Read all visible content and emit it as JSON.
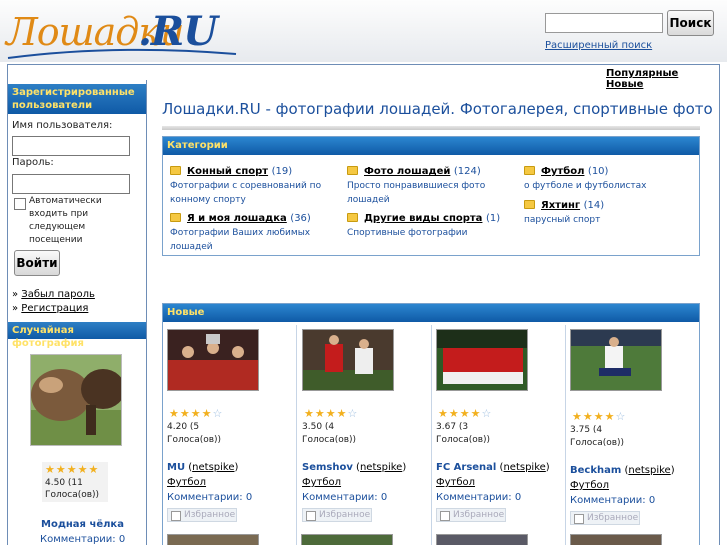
{
  "header": {
    "logo_cyr": "Лошадки",
    "logo_ru": ".RU",
    "search_button": "Поиск",
    "search_value": "",
    "advanced_search": "Расширенный поиск"
  },
  "toplinks": {
    "popular": "Популярные",
    "new": "Новые"
  },
  "sidebar": {
    "registered_heading": "Зарегистрированные пользователи",
    "username_label": "Имя пользователя:",
    "password_label": "Пароль:",
    "remember_label": "Автоматически входить при следующем посещении",
    "login_button": "Войти",
    "forgot_password": "Забыл пароль",
    "register": "Регистрация",
    "random_heading": "Случайная фотография",
    "random": {
      "rating_value": "4.50 (11",
      "votes": "Голоса(ов))",
      "title": "Модная чёлка",
      "comments": "Комментарии: 0",
      "stars": [
        1,
        1,
        1,
        1,
        0.5
      ]
    }
  },
  "main": {
    "title": "Лошадки.RU - фотографии лошадей. Фотогалерея, спортивные фото",
    "categories_heading": "Категории",
    "categories": [
      {
        "name": "Конный спорт",
        "count": "(19)",
        "desc": "Фотографии с соревнований по конному спорту"
      },
      {
        "name": "Фото лошадей",
        "count": "(124)",
        "desc": "Просто понравившиеся фото лошадей"
      },
      {
        "name": "Футбол",
        "count": "(10)",
        "desc": "о футболе и футболистах"
      },
      {
        "name": "Я и моя лошадка",
        "count": "(36)",
        "desc": "Фотографии Ваших любимых лошадей"
      },
      {
        "name": "Другие виды спорта",
        "count": "(1)",
        "desc": "Спортивные фотографии"
      },
      {
        "name": "Яхтинг",
        "count": "(14)",
        "desc": "парусный спорт"
      }
    ],
    "new_heading": "Новые",
    "new_photos": [
      {
        "rating_value": "4.20 (5",
        "votes": "Голоса(ов))",
        "title": "MU",
        "user": "netspike",
        "category": "Футбол",
        "comments": "Комментарии: 0",
        "favorite": "Избранное",
        "stars": [
          1,
          1,
          1,
          1,
          0
        ]
      },
      {
        "rating_value": "3.50 (4",
        "votes": "Голоса(ов))",
        "title": "Semshov",
        "user": "netspike",
        "category": "Футбол",
        "comments": "Комментарии: 0",
        "favorite": "Избранное",
        "stars": [
          1,
          1,
          1,
          0.5,
          0
        ]
      },
      {
        "rating_value": "3.67 (3",
        "votes": "Голоса(ов))",
        "title": "FC Arsenal",
        "user": "netspike",
        "category": "Футбол",
        "comments": "Комментарии: 0",
        "favorite": "Избранное",
        "stars": [
          1,
          1,
          1,
          0.5,
          0
        ]
      },
      {
        "rating_value": "3.75 (4",
        "votes": "Голоса(ов))",
        "title": "Beckham",
        "user": "netspike",
        "category": "Футбол",
        "comments": "Комментарии: 0",
        "favorite": "Избранное",
        "stars": [
          1,
          1,
          1,
          1,
          0
        ]
      }
    ]
  }
}
